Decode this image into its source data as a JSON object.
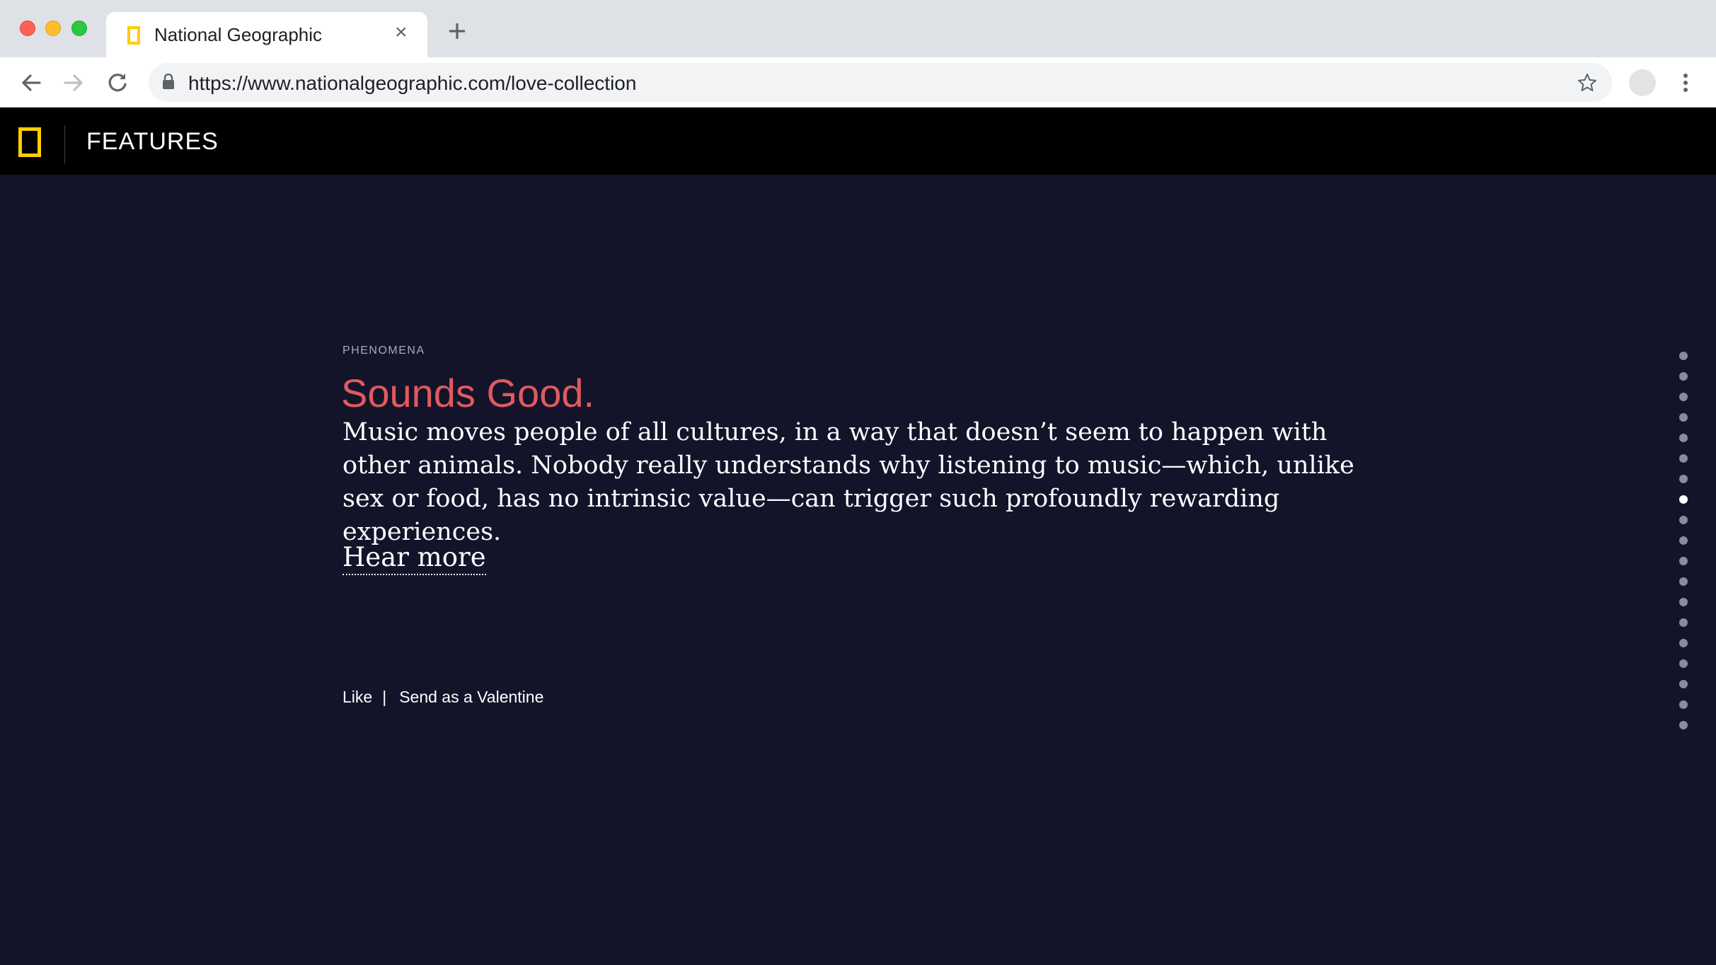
{
  "browser": {
    "tab_title": "National Geographic",
    "tab_close": "×",
    "url": "https://www.nationalgeographic.com/love-collection"
  },
  "header": {
    "title": "FEATURES"
  },
  "article": {
    "eyebrow": "PHENOMENA",
    "headline": "Sounds Good.",
    "body": "Music moves people of all cultures, in a way that doesn’t seem to happen with other animals. Nobody really understands why listening to music—which, unlike sex or food, has no intrinsic value—can trigger such profoundly rewarding experiences.",
    "cta": "Hear more",
    "headline_color": "#e05a5f"
  },
  "actions": {
    "like": "Like",
    "separator": "|",
    "send": "Send as a Valentine"
  },
  "pagination": {
    "total": 19,
    "active_index": 7
  },
  "colors": {
    "background": "#13142a",
    "header": "#000000",
    "logo": "#ffce00"
  }
}
